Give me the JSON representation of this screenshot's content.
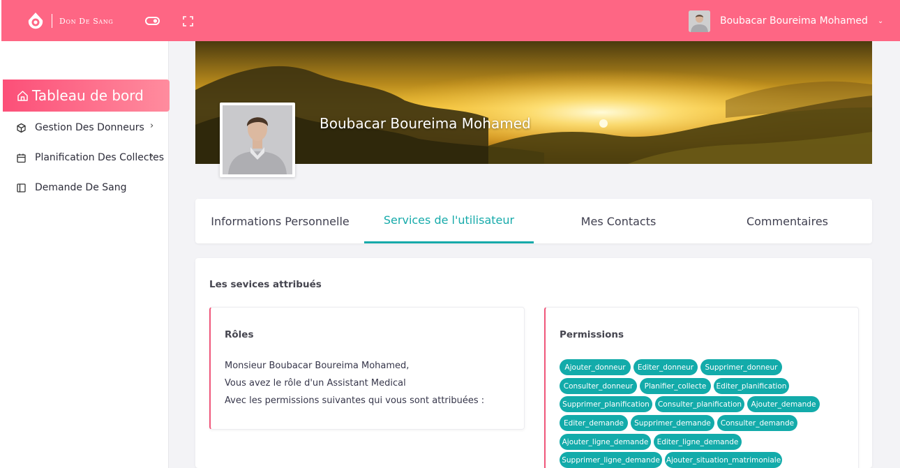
{
  "app": {
    "brand": "Don De Sang"
  },
  "header": {
    "user_name": "Boubacar Boureima Mohamed",
    "caret": "⌄"
  },
  "sidebar": {
    "active_item": {
      "label": "Tableau de bord"
    },
    "items": [
      {
        "label": "Gestion Des Donneurs",
        "chevron": "›"
      },
      {
        "label": "Planification Des Collectes",
        "chevron": "›"
      },
      {
        "label": "Demande De Sang"
      }
    ]
  },
  "profile": {
    "name": "Boubacar Boureima Mohamed"
  },
  "tabs": [
    {
      "label": "Informations Personnelle"
    },
    {
      "label": "Services de l'utilisateur"
    },
    {
      "label": "Mes Contacts"
    },
    {
      "label": "Commentaires"
    }
  ],
  "active_tab": "Services de l'utilisateur",
  "services": {
    "title": "Les sevices attribués",
    "roles": {
      "title": "Rôles",
      "lines": [
        "Monsieur Boubacar Boureima Mohamed,",
        "Vous avez le rôle d'un Assistant Medical",
        "Avec les permissions suivantes qui vous sont attribuées :"
      ]
    },
    "permissions": {
      "title": "Permissions",
      "tags": [
        "Ajouter_donneur",
        "Editer_donneur",
        "Supprimer_donneur",
        "Consulter_donneur",
        "Planifier_collecte",
        "Editer_planification",
        "Supprimer_planification",
        "Consulter_planification",
        "Ajouter_demande",
        "Editer_demande",
        "Supprimer_demande",
        "Consulter_demande",
        "Ajouter_ligne_demande",
        "Editer_ligne_demande",
        "Supprimer_ligne_demande",
        "Ajouter_situation_matrimoniale"
      ]
    }
  },
  "colors": {
    "header": "#fe6684",
    "sidebar_active_from": "#fc4f78",
    "sidebar_active_to": "#ff8c9e",
    "accent": "#16aaaa",
    "tag": "#13abaa",
    "card_border": "#f0567a"
  },
  "icons": {
    "brand": "blood-drop-logo-icon",
    "toggle": "toggle-icon",
    "fullscreen": "fullscreen-icon",
    "dashboard": "home-icon",
    "donors": "box-icon",
    "planning": "calendar-icon",
    "blood_request": "sidebar-panel-icon"
  }
}
